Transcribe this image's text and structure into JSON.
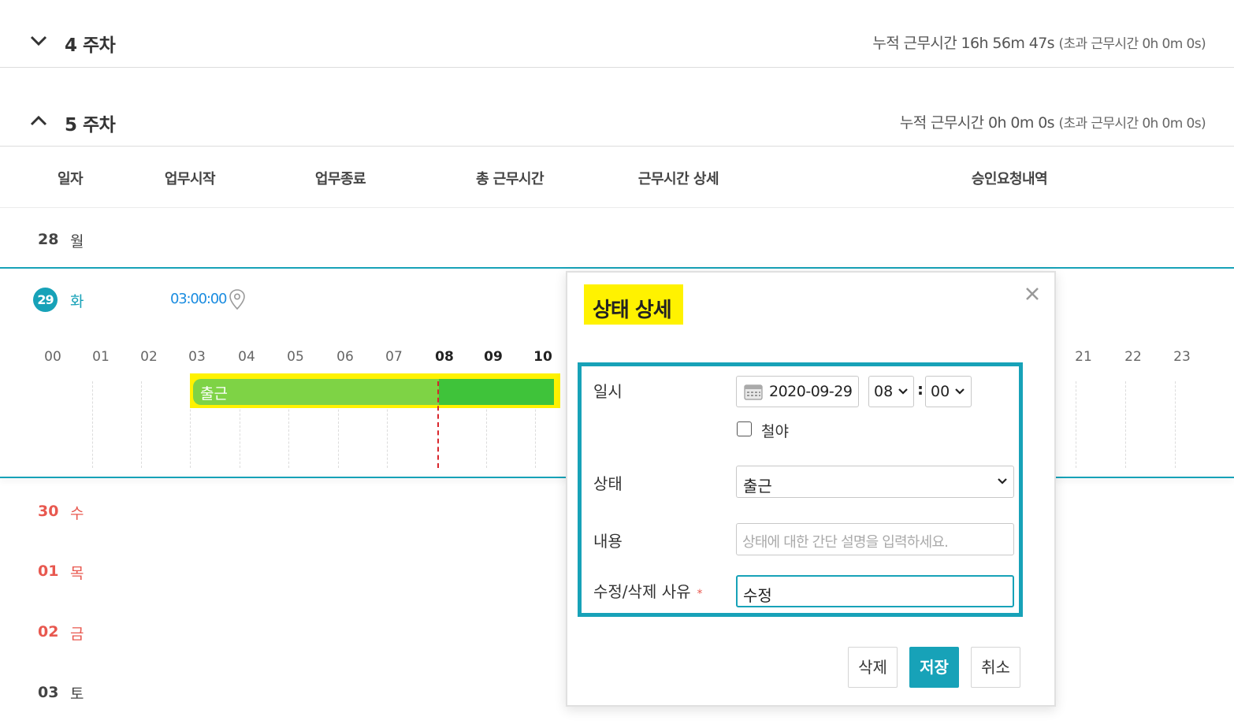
{
  "weeks": [
    {
      "title": "4 주차",
      "summary_label": "누적 근무시간 16h 56m 47s",
      "overtime_label": "(초과 근무시간 0h 0m 0s)",
      "expanded": false
    },
    {
      "title": "5 주차",
      "summary_label": "누적 근무시간 0h 0m 0s",
      "overtime_label": "(초과 근무시간 0h 0m 0s)",
      "expanded": true
    }
  ],
  "table": {
    "headers": [
      "일자",
      "업무시작",
      "업무종료",
      "총 근무시간",
      "근무시간 상세",
      "승인요청내역"
    ]
  },
  "days": [
    {
      "num": "28",
      "name": "월"
    },
    {
      "num": "29",
      "name": "화",
      "start_time": "03:00:00"
    },
    {
      "num": "30",
      "name": "수"
    },
    {
      "num": "01",
      "name": "목"
    },
    {
      "num": "02",
      "name": "금"
    },
    {
      "num": "03",
      "name": "토"
    }
  ],
  "timeline": {
    "hours": [
      "00",
      "01",
      "02",
      "03",
      "04",
      "05",
      "06",
      "07",
      "08",
      "09",
      "10",
      "21",
      "22",
      "23"
    ],
    "bar_label": "출근",
    "colors": {
      "bar_light": "#7ed345",
      "bar_dark": "#3fc33a",
      "highlight": "#fff200",
      "now_line": "#d9262c"
    }
  },
  "modal": {
    "title": "상태 상세",
    "datetime_label": "일시",
    "date_value": "2020-09-29",
    "hour_value": "08",
    "minute_value": "00",
    "colon": ":",
    "overnight_label": "철야",
    "overnight_checked": false,
    "status_label": "상태",
    "status_value": "출근",
    "content_label": "내용",
    "content_placeholder": "상태에 대한 간단 설명을 입력하세요.",
    "reason_label": "수정/삭제 사유",
    "reason_required": "*",
    "reason_value": "수정",
    "delete_button": "삭제",
    "save_button": "저장",
    "cancel_button": "취소"
  },
  "colors": {
    "accent": "#17a2b8",
    "weekend_red": "#e8584f",
    "time_blue": "#1a8ce0"
  }
}
